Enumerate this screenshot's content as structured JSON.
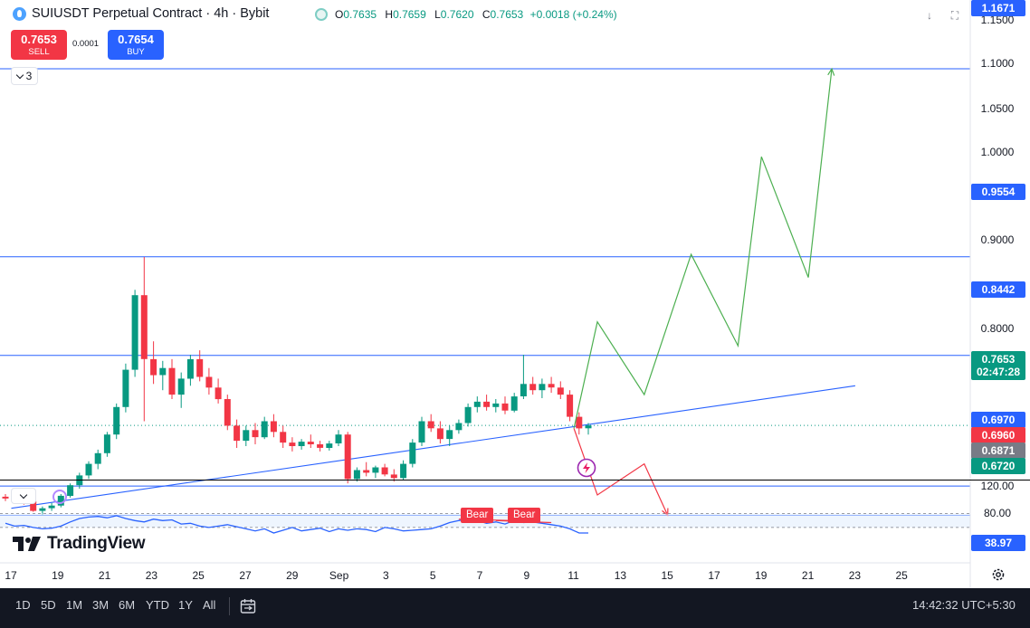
{
  "header": {
    "title": "SUIUSDT Perpetual Contract · 4h · Bybit",
    "ohlc": {
      "o_label": "O",
      "o": "0.7635",
      "h_label": "H",
      "h": "0.7659",
      "l_label": "L",
      "l": "0.7620",
      "c_label": "C",
      "c": "0.7653",
      "change": "+0.0018 (+0.24%)"
    }
  },
  "trade": {
    "sell_price": "0.7653",
    "sell_label": "SELL",
    "spread": "0.0001",
    "buy_price": "0.7654",
    "buy_label": "BUY"
  },
  "indicators": {
    "count": "3"
  },
  "price_axis": {
    "labels": [
      "1.1500",
      "1.1000",
      "1.0500",
      "1.0000",
      "0.9000",
      "0.8000",
      "120.00",
      "80.00"
    ],
    "tags": [
      {
        "text": "1.1671",
        "color": "#2962ff"
      },
      {
        "text": "0.9554",
        "color": "#2962ff"
      },
      {
        "text": "0.8442",
        "color": "#2962ff"
      },
      {
        "text": "0.7653",
        "color": "#089981"
      },
      {
        "text": "02:47:28",
        "color": "#089981"
      },
      {
        "text": "0.6970",
        "color": "#2962ff"
      },
      {
        "text": "0.6960",
        "color": "#f23645"
      },
      {
        "text": "0.6871",
        "color": "#787b86"
      },
      {
        "text": "0.6720",
        "color": "#089981"
      },
      {
        "text": "38.97",
        "color": "#2962ff"
      }
    ]
  },
  "rsi": {
    "bear_labels": [
      "Bear",
      "Bear"
    ]
  },
  "branding": {
    "logo_text": "TradingView"
  },
  "time_axis": [
    "17",
    "19",
    "21",
    "23",
    "25",
    "27",
    "29",
    "Sep",
    "3",
    "5",
    "7",
    "9",
    "11",
    "13",
    "15",
    "17",
    "19",
    "21",
    "23",
    "25"
  ],
  "toolbar": {
    "timeframes": [
      "1D",
      "5D",
      "1M",
      "3M",
      "6M",
      "YTD",
      "1Y",
      "All"
    ],
    "clock": "14:42:32 UTC+5:30"
  },
  "colors": {
    "up": "#089981",
    "down": "#f23645",
    "line": "#2962ff",
    "projection_up": "#4caf50",
    "projection_down": "#f23645"
  },
  "chart_data": {
    "type": "candlestick",
    "title": "SUIUSDT Perpetual Contract · 4h · Bybit",
    "interval": "4h",
    "ylim": [
      0.665,
      1.17
    ],
    "x": [
      "16 Aug",
      "26 Sep"
    ],
    "horizontal_levels": [
      1.1671,
      0.9554,
      0.8442,
      0.697,
      0.664
    ],
    "last_price": 0.7653,
    "trendline": [
      {
        "date": "2024-08-17",
        "price": 0.672
      },
      {
        "date": "2024-09-22",
        "price": 0.81
      }
    ],
    "candles": [
      [
        0.685,
        0.688,
        0.68,
        0.683
      ],
      [
        0.683,
        0.686,
        0.678,
        0.681
      ],
      [
        0.681,
        0.684,
        0.676,
        0.68
      ],
      [
        0.68,
        0.682,
        0.668,
        0.669
      ],
      [
        0.669,
        0.674,
        0.664,
        0.672
      ],
      [
        0.672,
        0.678,
        0.669,
        0.675
      ],
      [
        0.675,
        0.688,
        0.673,
        0.686
      ],
      [
        0.686,
        0.7,
        0.684,
        0.698
      ],
      [
        0.698,
        0.712,
        0.694,
        0.709
      ],
      [
        0.709,
        0.725,
        0.705,
        0.722
      ],
      [
        0.722,
        0.738,
        0.716,
        0.734
      ],
      [
        0.734,
        0.758,
        0.73,
        0.755
      ],
      [
        0.755,
        0.79,
        0.75,
        0.786
      ],
      [
        0.786,
        0.835,
        0.78,
        0.828
      ],
      [
        0.828,
        0.918,
        0.82,
        0.912
      ],
      [
        0.912,
        0.955,
        0.77,
        0.84
      ],
      [
        0.84,
        0.86,
        0.812,
        0.822
      ],
      [
        0.822,
        0.838,
        0.805,
        0.83
      ],
      [
        0.83,
        0.84,
        0.795,
        0.8
      ],
      [
        0.8,
        0.825,
        0.785,
        0.818
      ],
      [
        0.818,
        0.845,
        0.81,
        0.84
      ],
      [
        0.84,
        0.85,
        0.815,
        0.82
      ],
      [
        0.82,
        0.83,
        0.8,
        0.808
      ],
      [
        0.808,
        0.818,
        0.79,
        0.795
      ],
      [
        0.795,
        0.8,
        0.76,
        0.765
      ],
      [
        0.765,
        0.772,
        0.74,
        0.748
      ],
      [
        0.748,
        0.765,
        0.742,
        0.76
      ],
      [
        0.76,
        0.768,
        0.744,
        0.752
      ],
      [
        0.752,
        0.775,
        0.75,
        0.77
      ],
      [
        0.77,
        0.778,
        0.752,
        0.758
      ],
      [
        0.758,
        0.765,
        0.74,
        0.746
      ],
      [
        0.746,
        0.752,
        0.736,
        0.742
      ],
      [
        0.742,
        0.75,
        0.738,
        0.747
      ],
      [
        0.747,
        0.755,
        0.74,
        0.744
      ],
      [
        0.744,
        0.748,
        0.736,
        0.74
      ],
      [
        0.74,
        0.748,
        0.737,
        0.745
      ],
      [
        0.745,
        0.76,
        0.742,
        0.755
      ],
      [
        0.755,
        0.758,
        0.7,
        0.705
      ],
      [
        0.705,
        0.718,
        0.702,
        0.715
      ],
      [
        0.715,
        0.724,
        0.708,
        0.712
      ],
      [
        0.712,
        0.72,
        0.706,
        0.718
      ],
      [
        0.718,
        0.722,
        0.708,
        0.71
      ],
      [
        0.71,
        0.716,
        0.702,
        0.706
      ],
      [
        0.706,
        0.726,
        0.704,
        0.722
      ],
      [
        0.722,
        0.75,
        0.718,
        0.746
      ],
      [
        0.746,
        0.775,
        0.742,
        0.77
      ],
      [
        0.77,
        0.778,
        0.758,
        0.762
      ],
      [
        0.762,
        0.77,
        0.745,
        0.75
      ],
      [
        0.75,
        0.765,
        0.742,
        0.76
      ],
      [
        0.76,
        0.772,
        0.756,
        0.768
      ],
      [
        0.768,
        0.79,
        0.764,
        0.786
      ],
      [
        0.786,
        0.798,
        0.78,
        0.792
      ],
      [
        0.792,
        0.8,
        0.782,
        0.786
      ],
      [
        0.786,
        0.795,
        0.78,
        0.79
      ],
      [
        0.79,
        0.798,
        0.778,
        0.782
      ],
      [
        0.782,
        0.802,
        0.78,
        0.798
      ],
      [
        0.798,
        0.845,
        0.795,
        0.812
      ],
      [
        0.812,
        0.82,
        0.8,
        0.805
      ],
      [
        0.805,
        0.818,
        0.796,
        0.812
      ],
      [
        0.812,
        0.82,
        0.802,
        0.808
      ],
      [
        0.808,
        0.815,
        0.795,
        0.8
      ],
      [
        0.8,
        0.805,
        0.77,
        0.775
      ],
      [
        0.775,
        0.78,
        0.755,
        0.762
      ],
      [
        0.762,
        0.768,
        0.755,
        0.7653
      ]
    ],
    "projections": [
      {
        "color": "#4caf50",
        "points": [
          [
            "2024-09-10",
            0.762
          ],
          [
            "2024-09-11",
            0.882
          ],
          [
            "2024-09-13",
            0.8
          ],
          [
            "2024-09-15",
            0.958
          ],
          [
            "2024-09-17",
            0.855
          ],
          [
            "2024-09-18",
            1.068
          ],
          [
            "2024-09-20",
            0.932
          ],
          [
            "2024-09-21",
            1.167
          ]
        ]
      },
      {
        "color": "#f23645",
        "points": [
          [
            "2024-09-10",
            0.762
          ],
          [
            "2024-09-11",
            0.687
          ],
          [
            "2024-09-13",
            0.722
          ],
          [
            "2024-09-14",
            0.664
          ]
        ]
      }
    ],
    "rsi": {
      "ylim": [
        20,
        120
      ],
      "upper": 80,
      "lower": 60,
      "last": 38.97,
      "values": [
        66,
        62,
        63,
        60,
        58,
        59,
        62,
        68,
        73,
        75,
        76,
        74,
        77,
        73,
        70,
        68,
        72,
        70,
        71,
        65,
        66,
        62,
        60,
        62,
        64,
        61,
        58,
        55,
        58,
        52,
        56,
        60,
        55,
        57,
        59,
        54,
        58,
        56,
        58,
        57,
        54,
        60,
        58,
        55,
        56,
        57,
        58,
        62,
        67,
        70,
        72,
        70,
        66,
        68,
        65,
        70,
        67,
        68,
        66,
        64,
        62,
        58,
        52,
        52
      ]
    },
    "divergence_labels": [
      "Bear",
      "Bear"
    ]
  }
}
